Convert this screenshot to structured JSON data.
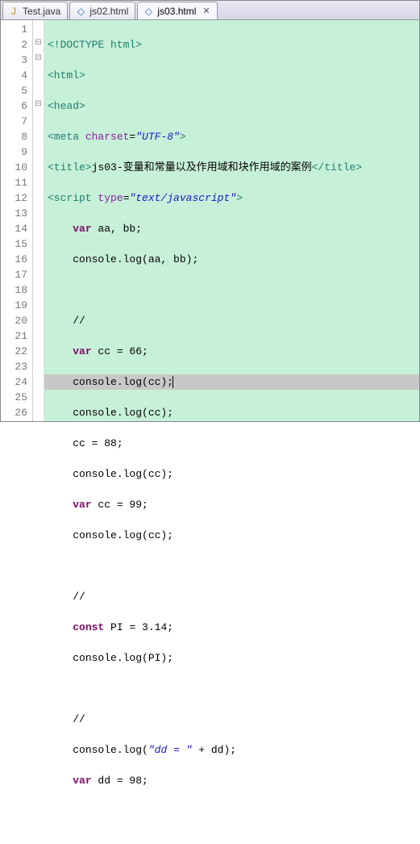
{
  "tabs": [
    {
      "label": "Test.java",
      "icon": "J",
      "iconColor": "#c58a13",
      "active": false
    },
    {
      "label": "js02.html",
      "icon": "◇",
      "iconColor": "#3366cc",
      "active": false
    },
    {
      "label": "js03.html",
      "icon": "◇",
      "iconColor": "#3366cc",
      "active": true,
      "closeGlyph": "✕"
    }
  ],
  "lineNumbers": [
    "1",
    "2",
    "3",
    "4",
    "5",
    "6",
    "7",
    "8",
    "9",
    "10",
    "11",
    "12",
    "13",
    "14",
    "15",
    "16",
    "17",
    "18",
    "19",
    "20",
    "21",
    "22",
    "23",
    "24",
    "25",
    "26"
  ],
  "foldMarks": {
    "l2": "⊟",
    "l3": "⊟",
    "l6": "⊟"
  },
  "code": {
    "l1": {
      "a": "<!",
      "b": "DOCTYPE",
      "c": " html>"
    },
    "l2": {
      "a": "<html>"
    },
    "l3": {
      "a": "<head>"
    },
    "l4": {
      "a": "<meta ",
      "b": "charset",
      "c": "=",
      "d": "\"UTF-8\"",
      "e": ">"
    },
    "l5": {
      "a": "<title>",
      "b": "js03-变量和常量以及作用域和块作用域的案例",
      "c": "</title>"
    },
    "l6": {
      "a": "<script ",
      "b": "type",
      "c": "=",
      "d": "\"text/javascript\"",
      "e": ">"
    },
    "l7": {
      "a": "var",
      "b": " aa, bb;"
    },
    "l8": {
      "a": "console.log(aa, bb);"
    },
    "l9": {
      "a": ""
    },
    "l10": {
      "a": "//"
    },
    "l11": {
      "a": "var",
      "b": " cc = 66;"
    },
    "l12": {
      "a": "console.log(cc);"
    },
    "l13": {
      "a": "console.log(cc);"
    },
    "l14": {
      "a": "cc = 88;"
    },
    "l15": {
      "a": "console.log(cc);"
    },
    "l16": {
      "a": "var",
      "b": " cc = 99;"
    },
    "l17": {
      "a": "console.log(cc);"
    },
    "l18": {
      "a": ""
    },
    "l19": {
      "a": "//"
    },
    "l20": {
      "a": "const",
      "b": " PI = 3.14;"
    },
    "l21": {
      "a": "console.log(PI);"
    },
    "l22": {
      "a": ""
    },
    "l23": {
      "a": "//"
    },
    "l24": {
      "a": "console.log(",
      "b": "\"dd = \"",
      "c": " + dd);"
    },
    "l25": {
      "a": "var",
      "b": " dd = 98;"
    },
    "l26": {
      "a": ""
    }
  },
  "indent1": "    ",
  "indent2": "        "
}
